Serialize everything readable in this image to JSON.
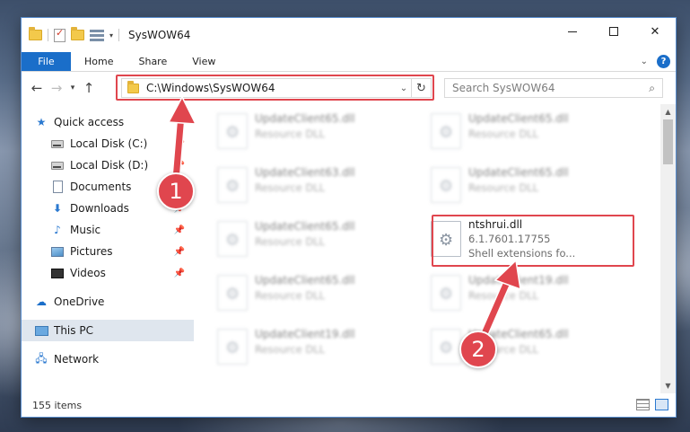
{
  "window": {
    "title": "SysWOW64"
  },
  "ribbon": {
    "tabs": [
      "File",
      "Home",
      "Share",
      "View"
    ],
    "help": "?"
  },
  "address": {
    "path": "C:\\Windows\\SysWOW64",
    "search_placeholder": "Search SysWOW64"
  },
  "sidebar": {
    "quick_access": "Quick access",
    "items": [
      {
        "label": "Local Disk (C:)",
        "icon": "drive-icon"
      },
      {
        "label": "Local Disk (D:)",
        "icon": "drive-icon"
      },
      {
        "label": "Documents",
        "icon": "documents-icon"
      },
      {
        "label": "Downloads",
        "icon": "downloads-icon"
      },
      {
        "label": "Music",
        "icon": "music-icon"
      },
      {
        "label": "Pictures",
        "icon": "pictures-icon"
      },
      {
        "label": "Videos",
        "icon": "videos-icon"
      }
    ],
    "onedrive": "OneDrive",
    "this_pc": "This PC",
    "network": "Network"
  },
  "files": {
    "col1": [
      {
        "name": "UpdateClient65.dll",
        "type": "Resource DLL"
      },
      {
        "name": "UpdateClient63.dll",
        "type": "Resource DLL"
      },
      {
        "name": "UpdateClient65.dll",
        "type": "Resource DLL"
      },
      {
        "name": "UpdateClient65.dll",
        "type": "Resource DLL"
      },
      {
        "name": "UpdateClient19.dll",
        "type": "Resource DLL"
      }
    ],
    "col2": [
      {
        "name": "UpdateClient65.dll",
        "type": "Resource DLL"
      },
      {
        "name": "UpdateClient65.dll",
        "type": "Resource DLL"
      },
      {
        "name": "UpdateClient19.dll",
        "type": "Resource DLL"
      },
      {
        "name": "UpdateClient65.dll",
        "type": "Resource DLL"
      }
    ],
    "highlighted": {
      "name": "ntshrui.dll",
      "version": "6.1.7601.17755",
      "description": "Shell extensions fo..."
    }
  },
  "status": {
    "count": "155 items"
  },
  "callouts": {
    "one": "1",
    "two": "2"
  },
  "colors": {
    "accent": "#1a6ec9",
    "highlight": "#e0464e"
  }
}
